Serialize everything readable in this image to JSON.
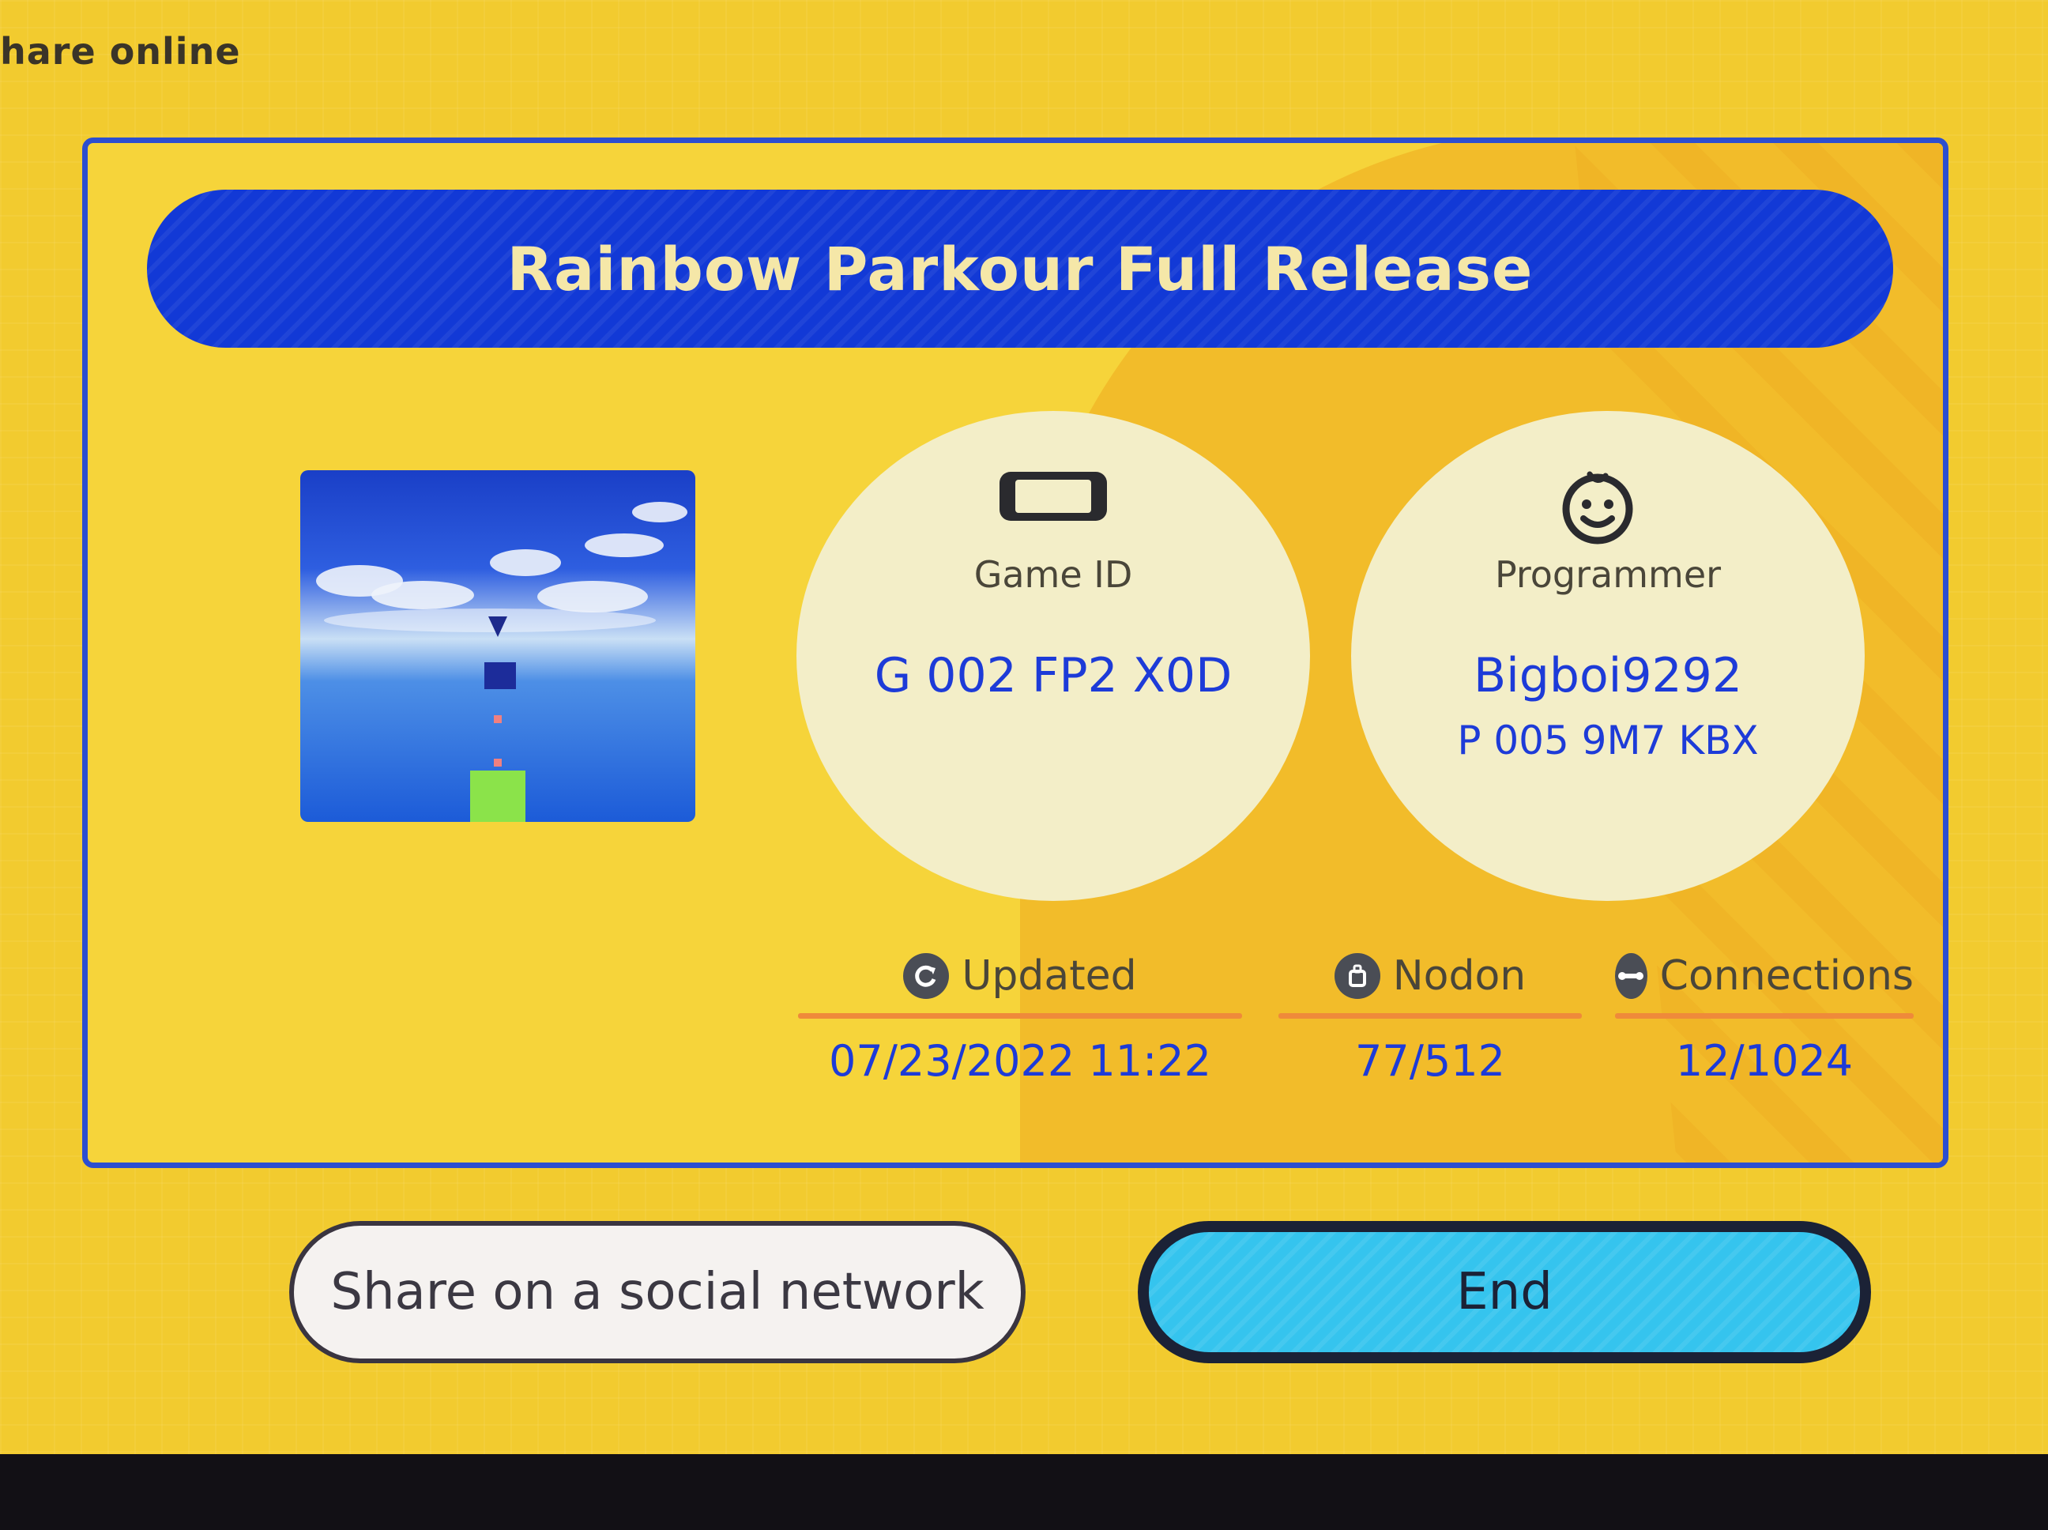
{
  "header": {
    "title": "hare online"
  },
  "card": {
    "title": "Rainbow Parkour Full Release",
    "game_id": {
      "label": "Game ID",
      "value": "G 002 FP2 X0D"
    },
    "programmer": {
      "label": "Programmer",
      "name": "Bigboi9292",
      "id": "P 005 9M7 KBX"
    },
    "stats": [
      {
        "label": "Updated",
        "value": "07/23/2022 11:22",
        "icon": "refresh-icon"
      },
      {
        "label": "Nodon",
        "value": "77/512",
        "icon": "nodon-icon"
      },
      {
        "label": "Connections",
        "value": "12/1024",
        "icon": "connection-icon"
      }
    ]
  },
  "buttons": {
    "share": "Share on a social network",
    "end": "End"
  },
  "colors": {
    "accent_blue": "#1239d6",
    "background_yellow": "#f2cb2f",
    "end_button": "#35c4ee",
    "divider_orange": "#ef8a3a"
  }
}
